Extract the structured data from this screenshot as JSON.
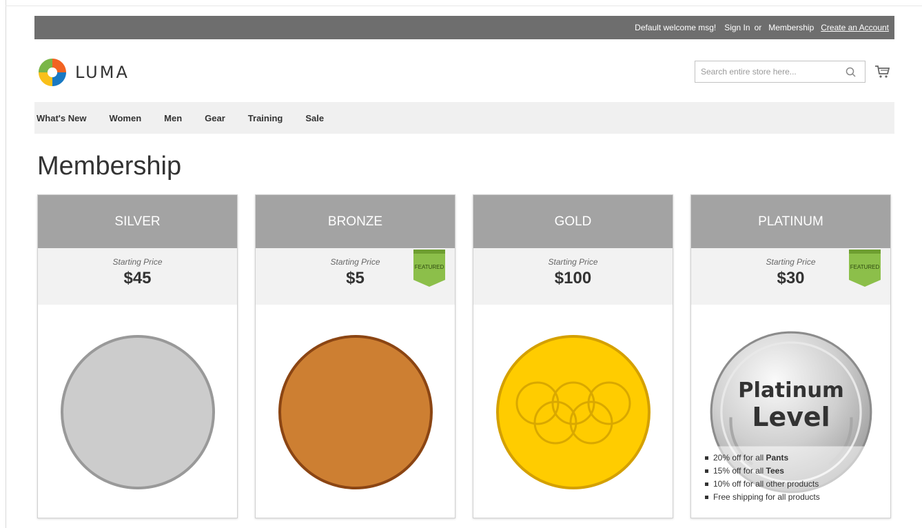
{
  "top_links": {
    "welcome": "Default welcome msg!",
    "sign_in": "Sign In",
    "or": "or",
    "membership": "Membership",
    "create_account": "Create an Account"
  },
  "header": {
    "logo_text": "LUMA",
    "search_placeholder": "Search entire store here..."
  },
  "nav": [
    "What's New",
    "Women",
    "Men",
    "Gear",
    "Training",
    "Sale"
  ],
  "page_title": "Membership",
  "price_label": "Starting Price",
  "ribbon_text": "FEATURED",
  "cards": [
    {
      "name": "SILVER",
      "price": "$45",
      "featured": false,
      "medal_color": "#cccccc"
    },
    {
      "name": "BRONZE",
      "price": "$5",
      "featured": true,
      "medal_color": "#cd7f32"
    },
    {
      "name": "GOLD",
      "price": "$100",
      "featured": false,
      "medal_color": "#ffcc00"
    },
    {
      "name": "PLATINUM",
      "price": "$30",
      "featured": true,
      "medal_color": "#c0c0c0"
    }
  ],
  "platinum_medal": {
    "line1": "Platinum",
    "line2": "Level"
  },
  "benefits": [
    {
      "pre": "20% off for all ",
      "bold": "Pants"
    },
    {
      "pre": "15% off for all ",
      "bold": "Tees"
    },
    {
      "pre": "10% off for all other products",
      "bold": ""
    },
    {
      "pre": "Free shipping for all products",
      "bold": ""
    }
  ]
}
